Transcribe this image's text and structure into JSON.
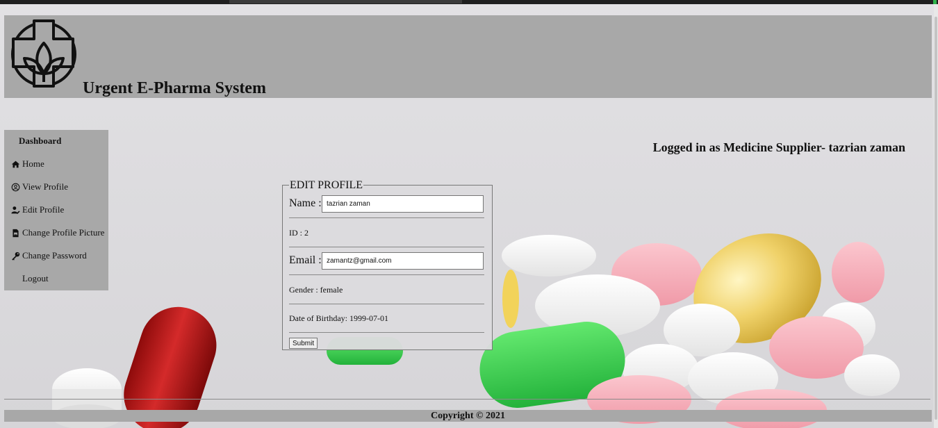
{
  "header": {
    "title": "Urgent E-Pharma System",
    "logo_icon": "pharmacy-cross-leaf-icon"
  },
  "status": {
    "logged_in_text": "Logged in as Medicine Supplier- tazrian zaman"
  },
  "sidebar": {
    "title": "Dashboard",
    "items": [
      {
        "label": "Home",
        "icon": "home-icon"
      },
      {
        "label": "View Profile",
        "icon": "user-circle-icon"
      },
      {
        "label": "Edit Profile",
        "icon": "user-edit-icon"
      },
      {
        "label": "Change Profile Picture",
        "icon": "file-image-icon"
      },
      {
        "label": "Change Password",
        "icon": "key-icon"
      },
      {
        "label": "Logout",
        "icon": ""
      }
    ]
  },
  "form": {
    "legend": "EDIT PROFILE",
    "name_label": "Name :",
    "name_value": "tazrian zaman",
    "id_text": "ID : 2",
    "email_label": "Email :",
    "email_value": "zamantz@gmail.com",
    "gender_text": "Gender : female",
    "dob_text": "Date of Birthday: 1999-07-01",
    "submit_label": "Submit"
  },
  "footer": {
    "copyright": "Copyright © 2021"
  },
  "colors": {
    "panel_gray": "#a8a8a8",
    "page_bg": "#dcdbde"
  }
}
